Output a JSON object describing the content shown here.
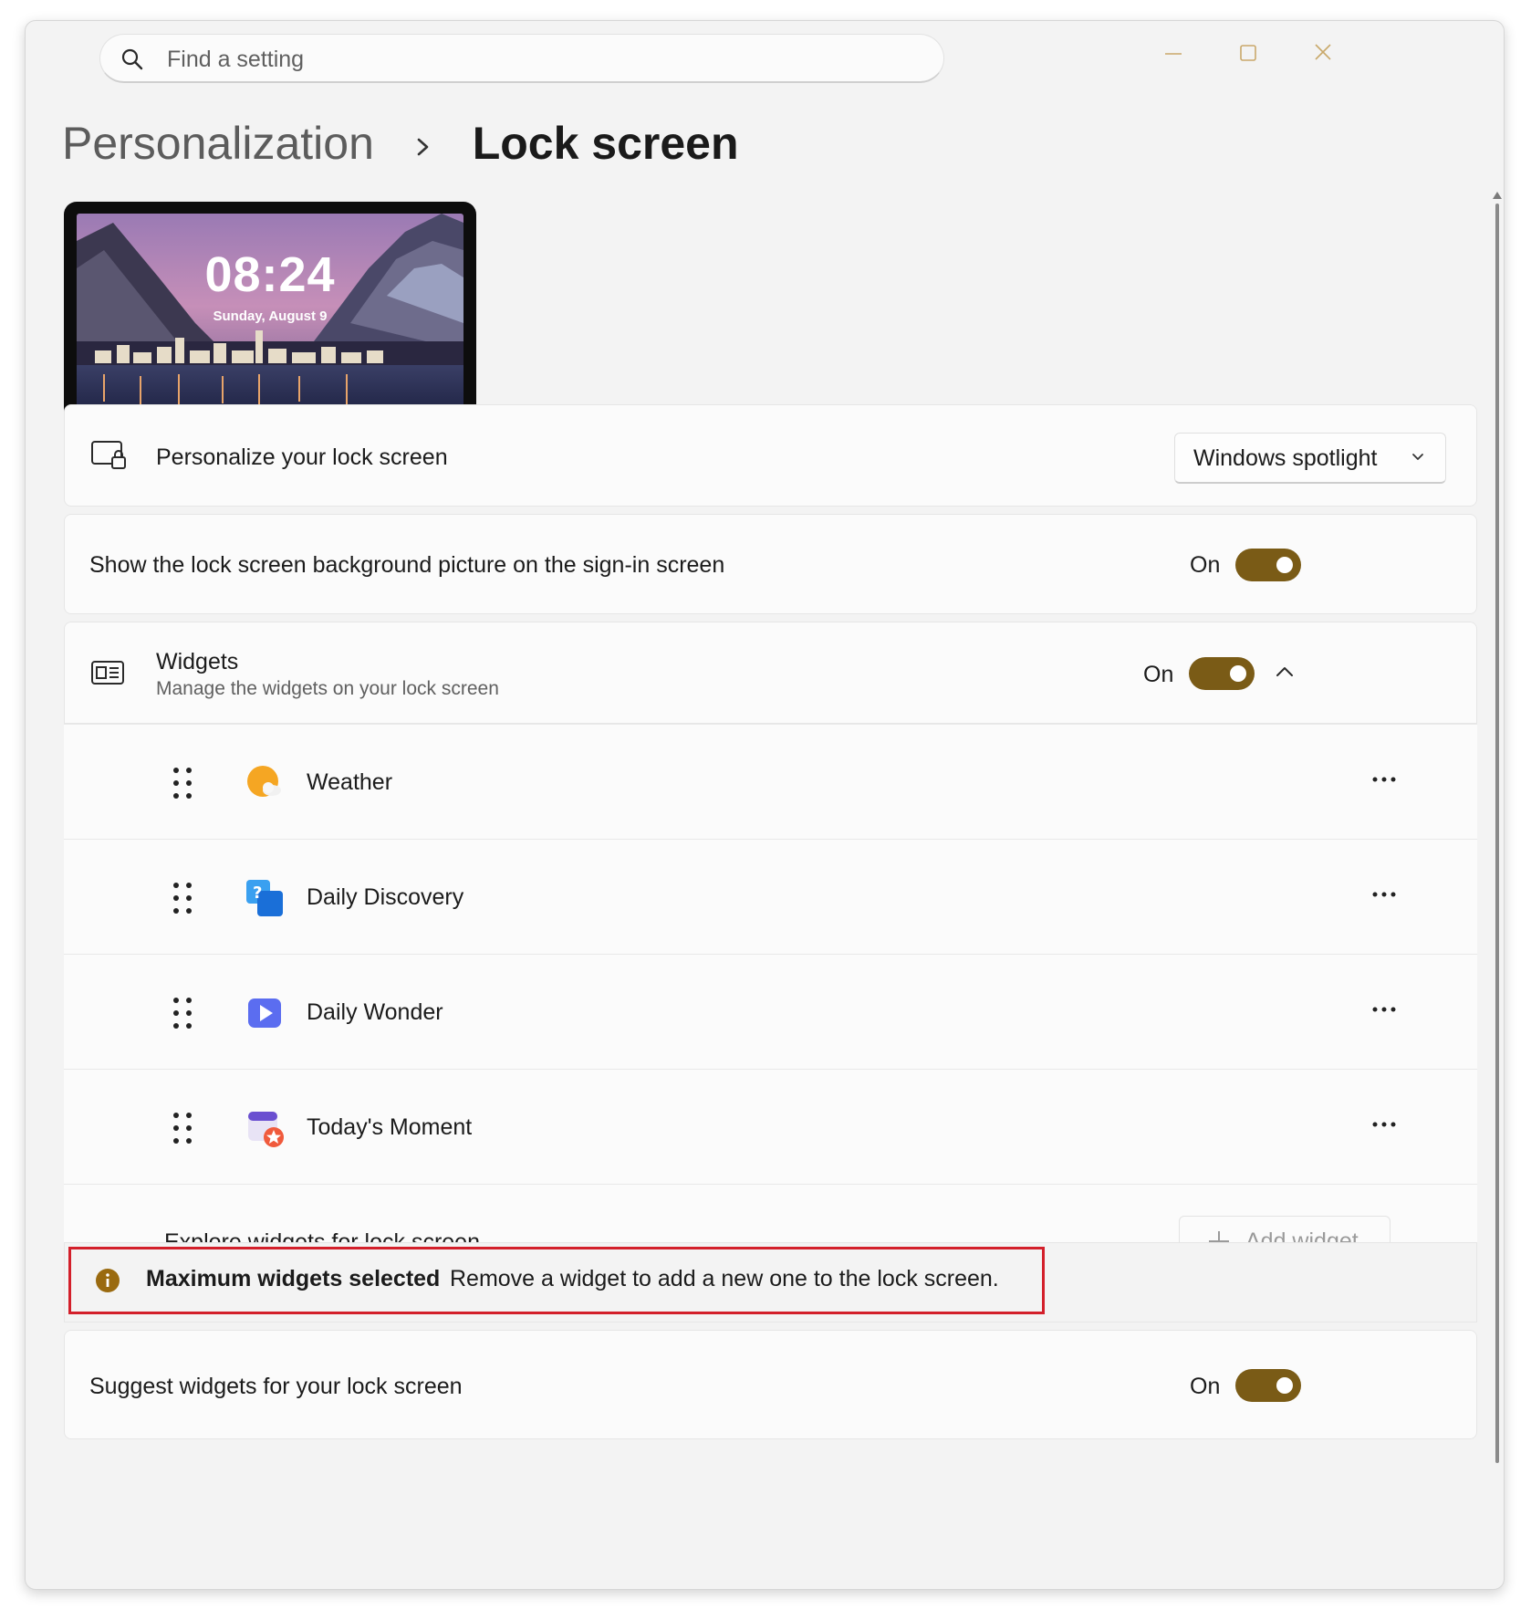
{
  "search": {
    "placeholder": "Find a setting"
  },
  "window_controls": [
    "minimize",
    "maximize",
    "close"
  ],
  "breadcrumb": {
    "parent": "Personalization",
    "current": "Lock screen"
  },
  "preview": {
    "time": "08:24",
    "date": "Sunday, August 9"
  },
  "personalize": {
    "label": "Personalize your lock screen",
    "dropdown_value": "Windows spotlight"
  },
  "signin_background": {
    "label": "Show the lock screen background picture on the sign-in screen",
    "state": "On"
  },
  "widgets": {
    "title": "Widgets",
    "description": "Manage the widgets on your lock screen",
    "state": "On",
    "items": [
      {
        "name": "Weather",
        "icon": "weather-icon"
      },
      {
        "name": "Daily Discovery",
        "icon": "daily-discovery-icon"
      },
      {
        "name": "Daily Wonder",
        "icon": "daily-wonder-icon"
      },
      {
        "name": "Today's Moment",
        "icon": "todays-moment-icon"
      }
    ],
    "explore_label": "Explore widgets for lock screen",
    "add_button": "Add widget"
  },
  "info": {
    "title": "Maximum widgets selected",
    "message": "Remove a widget to add a new one to the lock screen."
  },
  "suggest": {
    "label": "Suggest widgets for your lock screen",
    "state": "On"
  },
  "colors": {
    "accent": "#7a5b16",
    "highlight_border": "#d31f2a",
    "info_icon": "#9a6a0f"
  }
}
